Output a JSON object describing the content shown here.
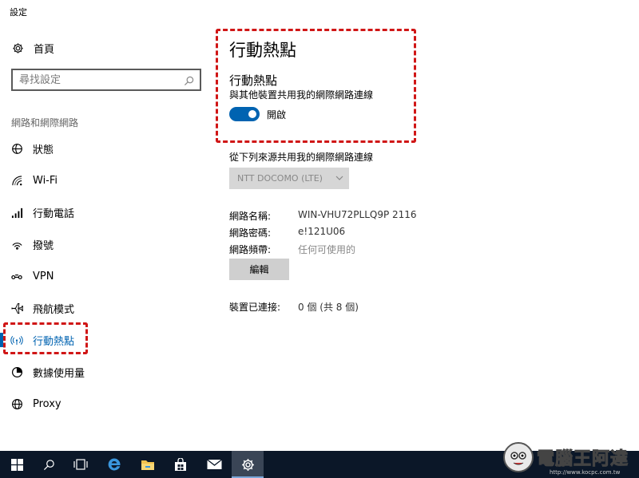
{
  "window": {
    "title": "設定"
  },
  "sidebar": {
    "home_label": "首頁",
    "search_placeholder": "尋找設定",
    "section_label": "網路和網際網路",
    "items": [
      {
        "label": "狀態",
        "icon": "status-icon"
      },
      {
        "label": "Wi-Fi",
        "icon": "wifi-icon"
      },
      {
        "label": "行動電話",
        "icon": "cellular-icon"
      },
      {
        "label": "撥號",
        "icon": "dialup-icon"
      },
      {
        "label": "VPN",
        "icon": "vpn-icon"
      },
      {
        "label": "飛航模式",
        "icon": "airplane-icon"
      },
      {
        "label": "行動熱點",
        "icon": "hotspot-icon",
        "active": true
      },
      {
        "label": "數據使用量",
        "icon": "data-usage-icon"
      },
      {
        "label": "Proxy",
        "icon": "globe-icon"
      }
    ]
  },
  "main": {
    "page_title": "行動熱點",
    "hotspot": {
      "title": "行動熱點",
      "description": "與其他裝置共用我的網際網路連線",
      "toggle_state": "開啟",
      "toggle_on": true
    },
    "share_from_label": "從下列來源共用我的網際網路連線",
    "share_from_value": "NTT DOCOMO (LTE)",
    "network_name_label": "網路名稱:",
    "network_name_value": "WIN-VHU72PLLQ9P 2116",
    "network_password_label": "網路密碼:",
    "network_password_value": "e!121U06",
    "network_band_label": "網路頻帶:",
    "network_band_value": "任何可使用的",
    "edit_button": "編輯",
    "devices_label": "裝置已連接:",
    "devices_value": "0 個 (共 8 個)"
  },
  "taskbar": {
    "items": [
      "windows-start-icon",
      "search-icon",
      "task-view-icon",
      "edge-icon",
      "file-explorer-icon",
      "store-icon",
      "mail-icon",
      "settings-icon"
    ],
    "active": "settings-icon"
  },
  "watermark": {
    "text": "電腦王阿達",
    "url": "http://www.kocpc.com.tw"
  },
  "colors": {
    "accent": "#0063b1",
    "highlight": "#d01616",
    "taskbar": "#0b1728"
  }
}
